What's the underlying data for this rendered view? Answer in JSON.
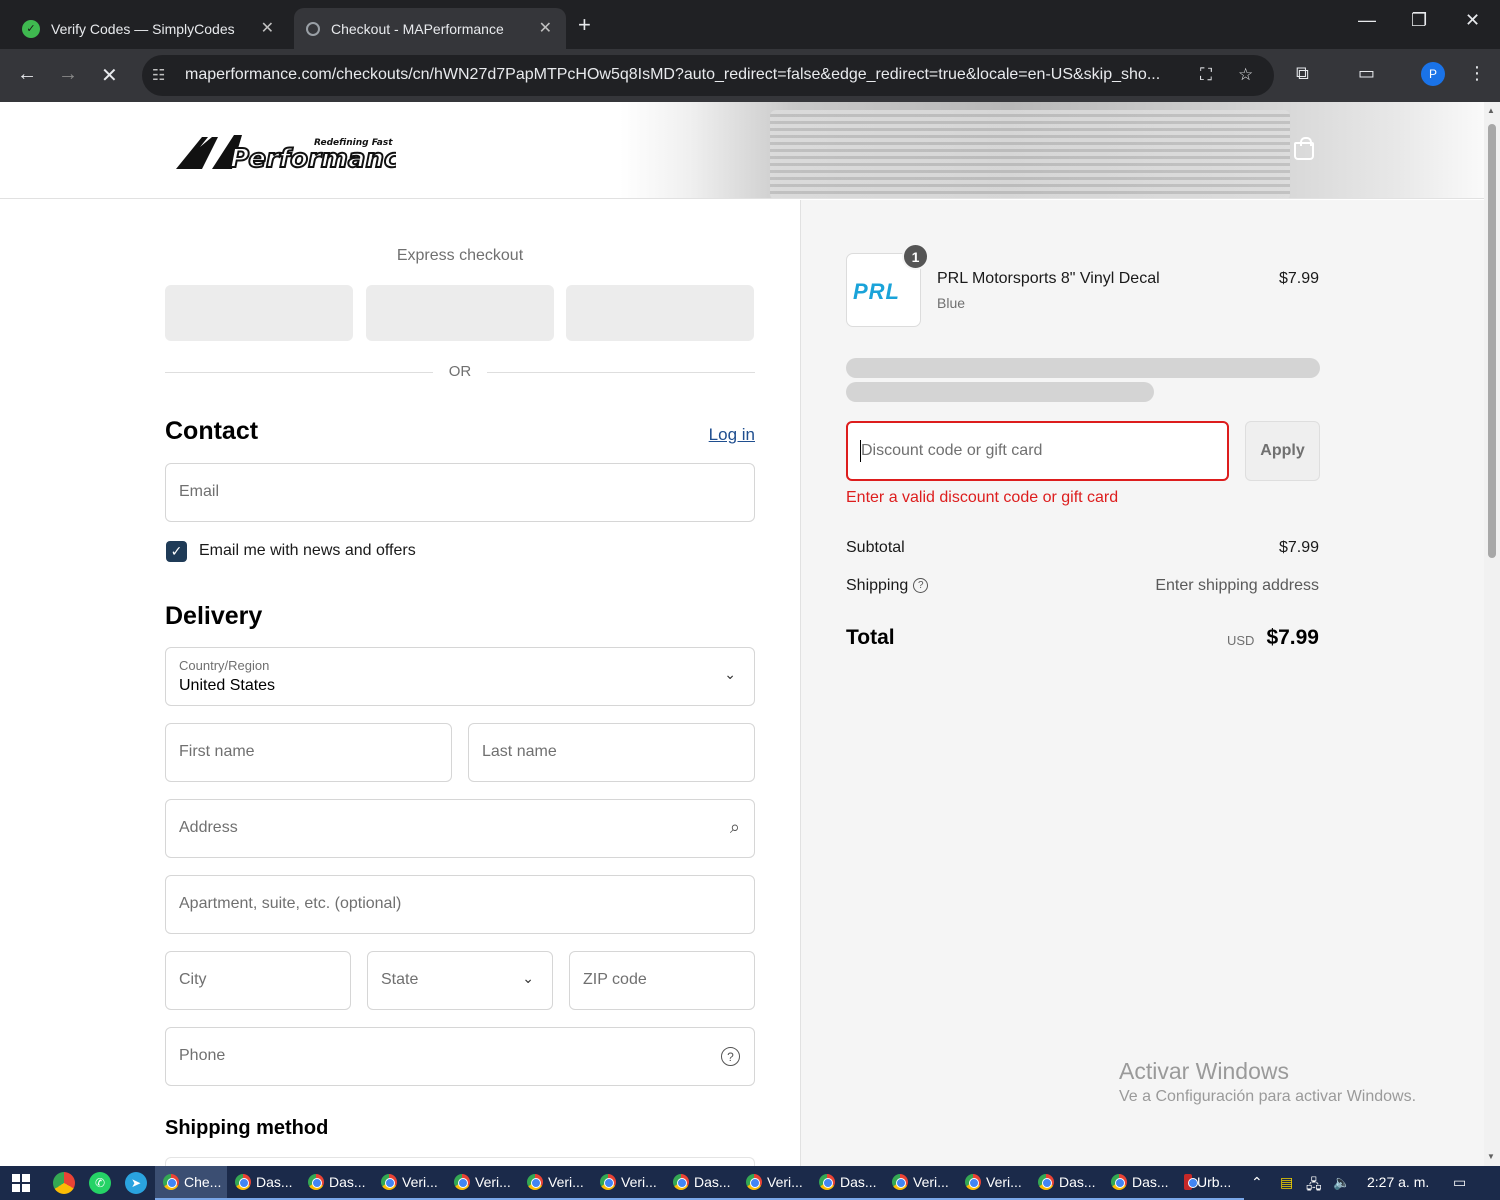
{
  "browser": {
    "tabs": [
      {
        "title": "Verify Codes — SimplyCodes",
        "active": false
      },
      {
        "title": "Checkout - MAPerformance",
        "active": true
      }
    ],
    "url": "maperformance.com/checkouts/cn/hWN27d7PapMTPcHOw5q8IsMD?auto_redirect=false&edge_redirect=true&locale=en-US&skip_sho...",
    "profile_initial": "P"
  },
  "header": {
    "logo_text": "MAPerformance",
    "logo_tagline": "Redefining Fast"
  },
  "checkout": {
    "express_label": "Express checkout",
    "or_label": "OR",
    "contact_heading": "Contact",
    "login_label": "Log in",
    "email_placeholder": "Email",
    "newsletter_label": "Email me with news and offers",
    "newsletter_checked": true,
    "delivery_heading": "Delivery",
    "country_label": "Country/Region",
    "country_value": "United States",
    "first_name_placeholder": "First name",
    "last_name_placeholder": "Last name",
    "address_placeholder": "Address",
    "apartment_placeholder": "Apartment, suite, etc. (optional)",
    "city_placeholder": "City",
    "state_placeholder": "State",
    "zip_placeholder": "ZIP code",
    "phone_placeholder": "Phone",
    "shipping_method_heading": "Shipping method"
  },
  "summary": {
    "item": {
      "quantity": "1",
      "thumb_text": "PRL",
      "name": "PRL Motorsports 8\" Vinyl Decal",
      "variant": "Blue",
      "price": "$7.99"
    },
    "discount_placeholder": "Discount code or gift card",
    "apply_label": "Apply",
    "discount_error": "Enter a valid discount code or gift card",
    "subtotal_label": "Subtotal",
    "subtotal_value": "$7.99",
    "shipping_label": "Shipping",
    "shipping_value": "Enter shipping address",
    "total_label": "Total",
    "total_currency": "USD",
    "total_value": "$7.99"
  },
  "watermark": {
    "title": "Activar Windows",
    "subtitle": "Ve a Configuración para activar Windows."
  },
  "taskbar": {
    "apps": [
      "Che...",
      "Das...",
      "Das...",
      "Veri...",
      "Veri...",
      "Veri...",
      "Veri...",
      "Das...",
      "Veri...",
      "Das...",
      "Veri...",
      "Veri...",
      "Das...",
      "Das...",
      "Urb..."
    ],
    "clock": "2:27 a. m."
  },
  "colors": {
    "error": "#dd1d1d",
    "link": "#1f4e8f",
    "checkbox": "#1f3b57",
    "summary_bg": "#f5f5f5"
  }
}
